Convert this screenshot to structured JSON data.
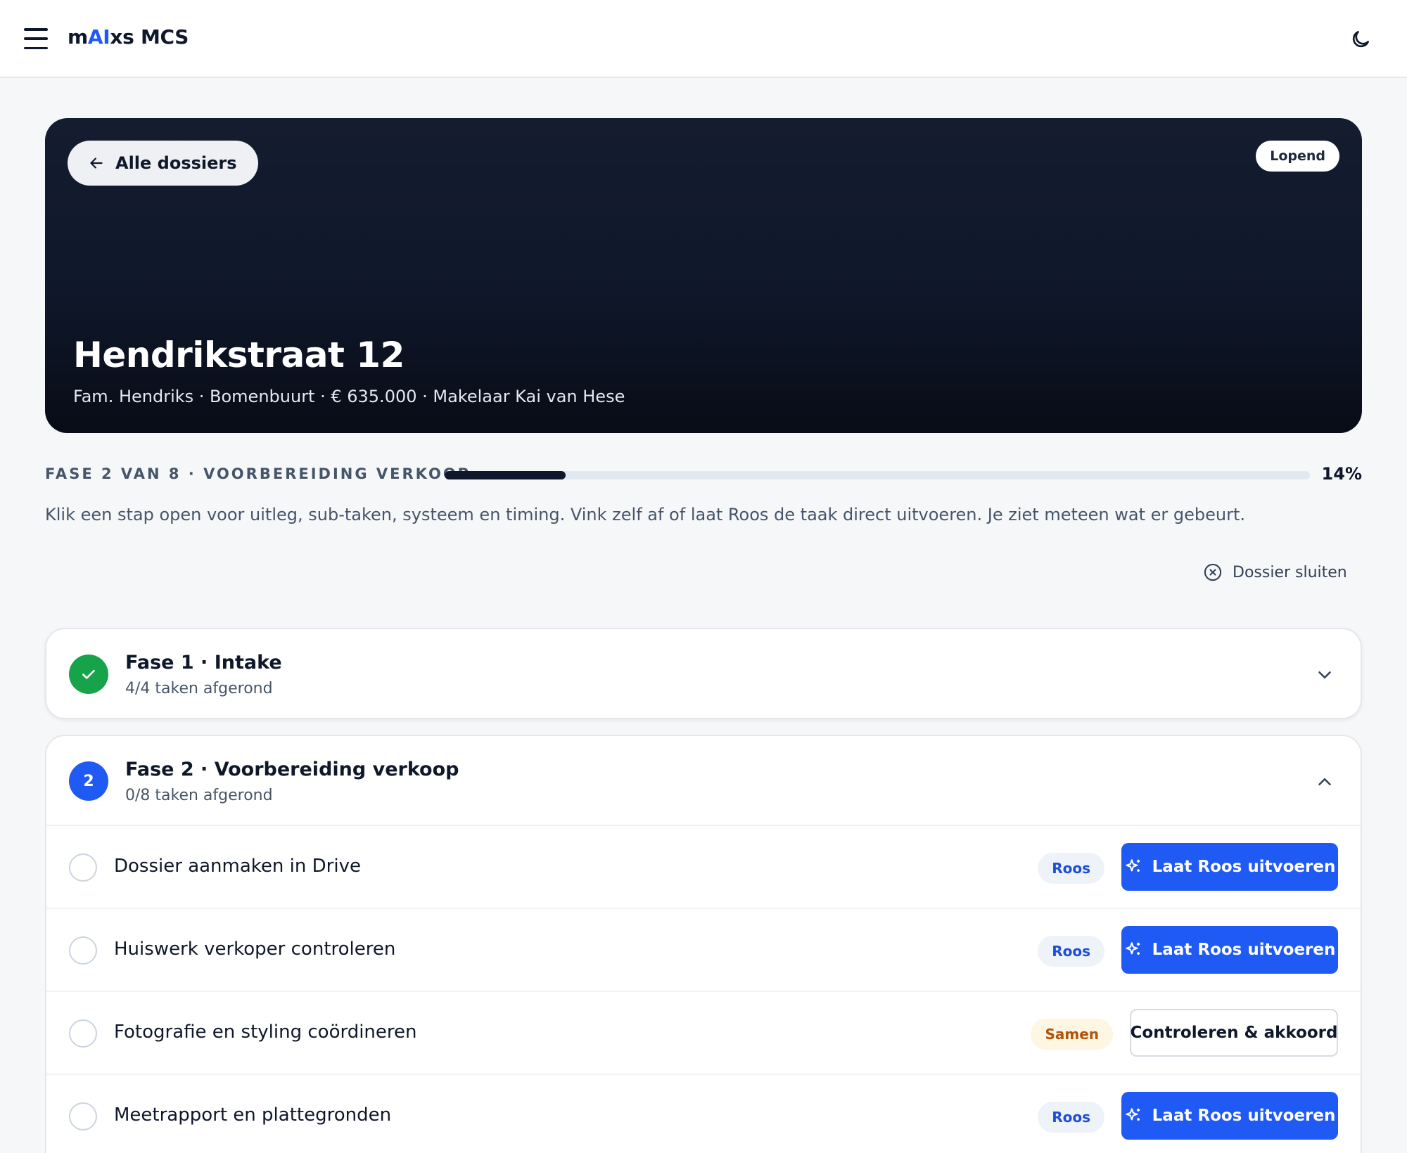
{
  "app": {
    "brand_prefix": "m",
    "brand_ai": "AI",
    "brand_suffix": "xs MCS",
    "menu_icon": "hamburger-menu-icon",
    "theme_icon": "moon-icon"
  },
  "hero": {
    "back_label": "Alle dossiers",
    "status": "Lopend",
    "title": "Hendrikstraat 12",
    "subtitle": "Fam. Hendriks · Bomenbuurt · € 635.000 · Makelaar Kai van Hese"
  },
  "progress": {
    "label": "FASE 2 VAN 8 · VOORBEREIDING VERKOOP",
    "percent_label": "14%",
    "value": 0.14
  },
  "intro": "Klik een stap open voor uitleg, sub-taken, systeem en timing. Vink zelf af of laat Roos de taak direct uitvoeren. Je ziet meteen wat er gebeurt.",
  "close_dossier_label": "Dossier sluiten",
  "phases": [
    {
      "title": "Fase 1 · Intake",
      "count": "4/4 taken afgerond",
      "state": "done",
      "expanded": false
    },
    {
      "number": "2",
      "title": "Fase 2 · Voorbereiding verkoop",
      "count": "0/8 taken afgerond",
      "state": "active",
      "expanded": true
    }
  ],
  "tasks": [
    {
      "name": "Dossier aanmaken in Drive",
      "badge": "Roos",
      "action": "Laat Roos uitvoeren"
    },
    {
      "name": "Huiswerk verkoper controleren",
      "badge": "Roos",
      "action": "Laat Roos uitvoeren"
    },
    {
      "name": "Fotografie en styling coördineren",
      "badge": "Samen",
      "action": "Controleren & akkoord"
    },
    {
      "name": "Meetrapport en plattegronden",
      "badge": "Roos",
      "action": "Laat Roos uitvoeren"
    }
  ],
  "colors": {
    "accent": "#1f5af5",
    "success": "#16a34a",
    "hero_bg": "#0f172a",
    "samen_badge": "#b45309"
  }
}
